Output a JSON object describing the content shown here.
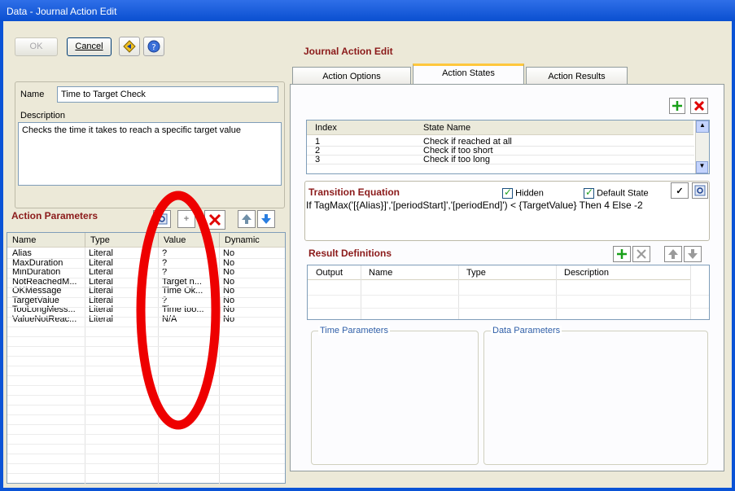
{
  "window": {
    "title": "Data - Journal Action Edit"
  },
  "toolbar": {
    "ok_label": "OK",
    "cancel_label": "Cancel"
  },
  "header": {
    "title": "Journal Action Edit"
  },
  "form": {
    "name_label": "Name",
    "name_value": "Time to Target Check",
    "description_label": "Description",
    "description_value": "Checks the time it takes to reach a specific target value"
  },
  "action_parameters": {
    "title": "Action Parameters",
    "columns": [
      "Name",
      "Type",
      "Value",
      "Dynamic"
    ],
    "rows": [
      [
        "Alias",
        "Literal",
        "?",
        "No"
      ],
      [
        "MaxDuration",
        "Literal",
        "?",
        "No"
      ],
      [
        "MinDuration",
        "Literal",
        "?",
        "No"
      ],
      [
        "NotReachedM...",
        "Literal",
        "Target n...",
        "No"
      ],
      [
        "OKMessage",
        "Literal",
        "Time Ok...",
        "No"
      ],
      [
        "TargetValue",
        "Literal",
        "?",
        "No"
      ],
      [
        "TooLongMess...",
        "Literal",
        "Time too...",
        "No"
      ],
      [
        "ValueNotReac...",
        "Literal",
        "N/A",
        "No"
      ]
    ]
  },
  "tabs": [
    {
      "label": "Action Options"
    },
    {
      "label": "Action States"
    },
    {
      "label": "Action Results"
    }
  ],
  "states": {
    "columns": [
      "Index",
      "State Name"
    ],
    "rows": [
      [
        "1",
        "Check if reached at all"
      ],
      [
        "2",
        "Check if too short"
      ],
      [
        "3",
        "Check if too long"
      ]
    ]
  },
  "transition": {
    "title": "Transition Equation",
    "hidden_label": "Hidden",
    "default_state_label": "Default State",
    "equation": "If TagMax('[{Alias}]','[periodStart]','[periodEnd]') < {TargetValue} Then 4 Else -2"
  },
  "result_definitions": {
    "title": "Result Definitions",
    "columns": [
      "Output",
      "Name",
      "Type",
      "Description"
    ]
  },
  "groups": {
    "time_parameters": "Time Parameters",
    "data_parameters": "Data Parameters"
  },
  "colors": {
    "accent_red": "#8b1a1a",
    "annotation_red": "#ee0000",
    "title_blue": "#0a53d6"
  }
}
